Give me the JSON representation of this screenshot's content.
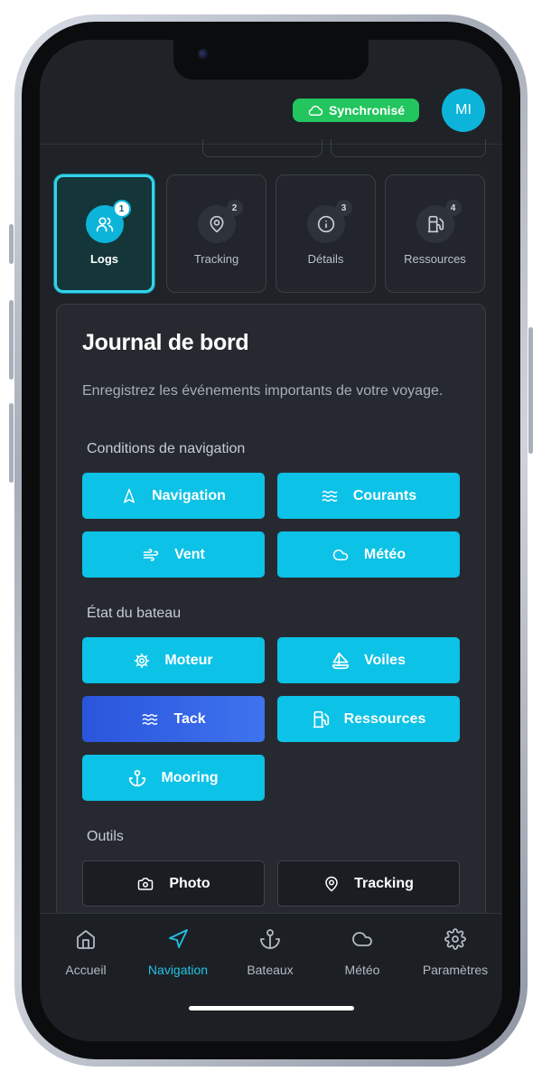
{
  "header": {
    "sync_label": "Synchronisé",
    "avatar_initials": "MI"
  },
  "steps": [
    {
      "number": "1",
      "label": "Logs",
      "active": true
    },
    {
      "number": "2",
      "label": "Tracking",
      "active": false
    },
    {
      "number": "3",
      "label": "Détails",
      "active": false
    },
    {
      "number": "4",
      "label": "Ressources",
      "active": false
    }
  ],
  "card": {
    "title": "Journal de bord",
    "description": "Enregistrez les événements importants de votre voyage.",
    "sections": {
      "conditions": {
        "label": "Conditions de navigation",
        "buttons": [
          {
            "label": "Navigation",
            "icon": "navigation-arrow-icon"
          },
          {
            "label": "Courants",
            "icon": "waves-icon"
          },
          {
            "label": "Vent",
            "icon": "wind-icon"
          },
          {
            "label": "Météo",
            "icon": "cloud-icon"
          }
        ]
      },
      "boat_state": {
        "label": "État du bateau",
        "buttons": [
          {
            "label": "Moteur",
            "icon": "engine-cog-icon"
          },
          {
            "label": "Voiles",
            "icon": "sailboat-icon"
          },
          {
            "label": "Tack",
            "icon": "waves-icon",
            "selected": true
          },
          {
            "label": "Ressources",
            "icon": "fuel-icon"
          },
          {
            "label": "Mooring",
            "icon": "anchor-icon"
          }
        ]
      },
      "tools": {
        "label": "Outils",
        "buttons": [
          {
            "label": "Photo",
            "icon": "camera-icon"
          },
          {
            "label": "Tracking",
            "icon": "map-pin-icon"
          }
        ]
      }
    }
  },
  "bottom_nav": [
    {
      "label": "Accueil",
      "icon": "home-icon",
      "active": false
    },
    {
      "label": "Navigation",
      "icon": "navigation-arrow-icon",
      "active": true
    },
    {
      "label": "Bateaux",
      "icon": "anchor-icon",
      "active": false
    },
    {
      "label": "Météo",
      "icon": "cloud-icon",
      "active": false
    },
    {
      "label": "Paramètres",
      "icon": "gear-icon",
      "active": false
    }
  ],
  "colors": {
    "accent": "#0cc2e6",
    "selected": "#2a55dc",
    "sync": "#22c55e",
    "background": "#1f2328"
  }
}
